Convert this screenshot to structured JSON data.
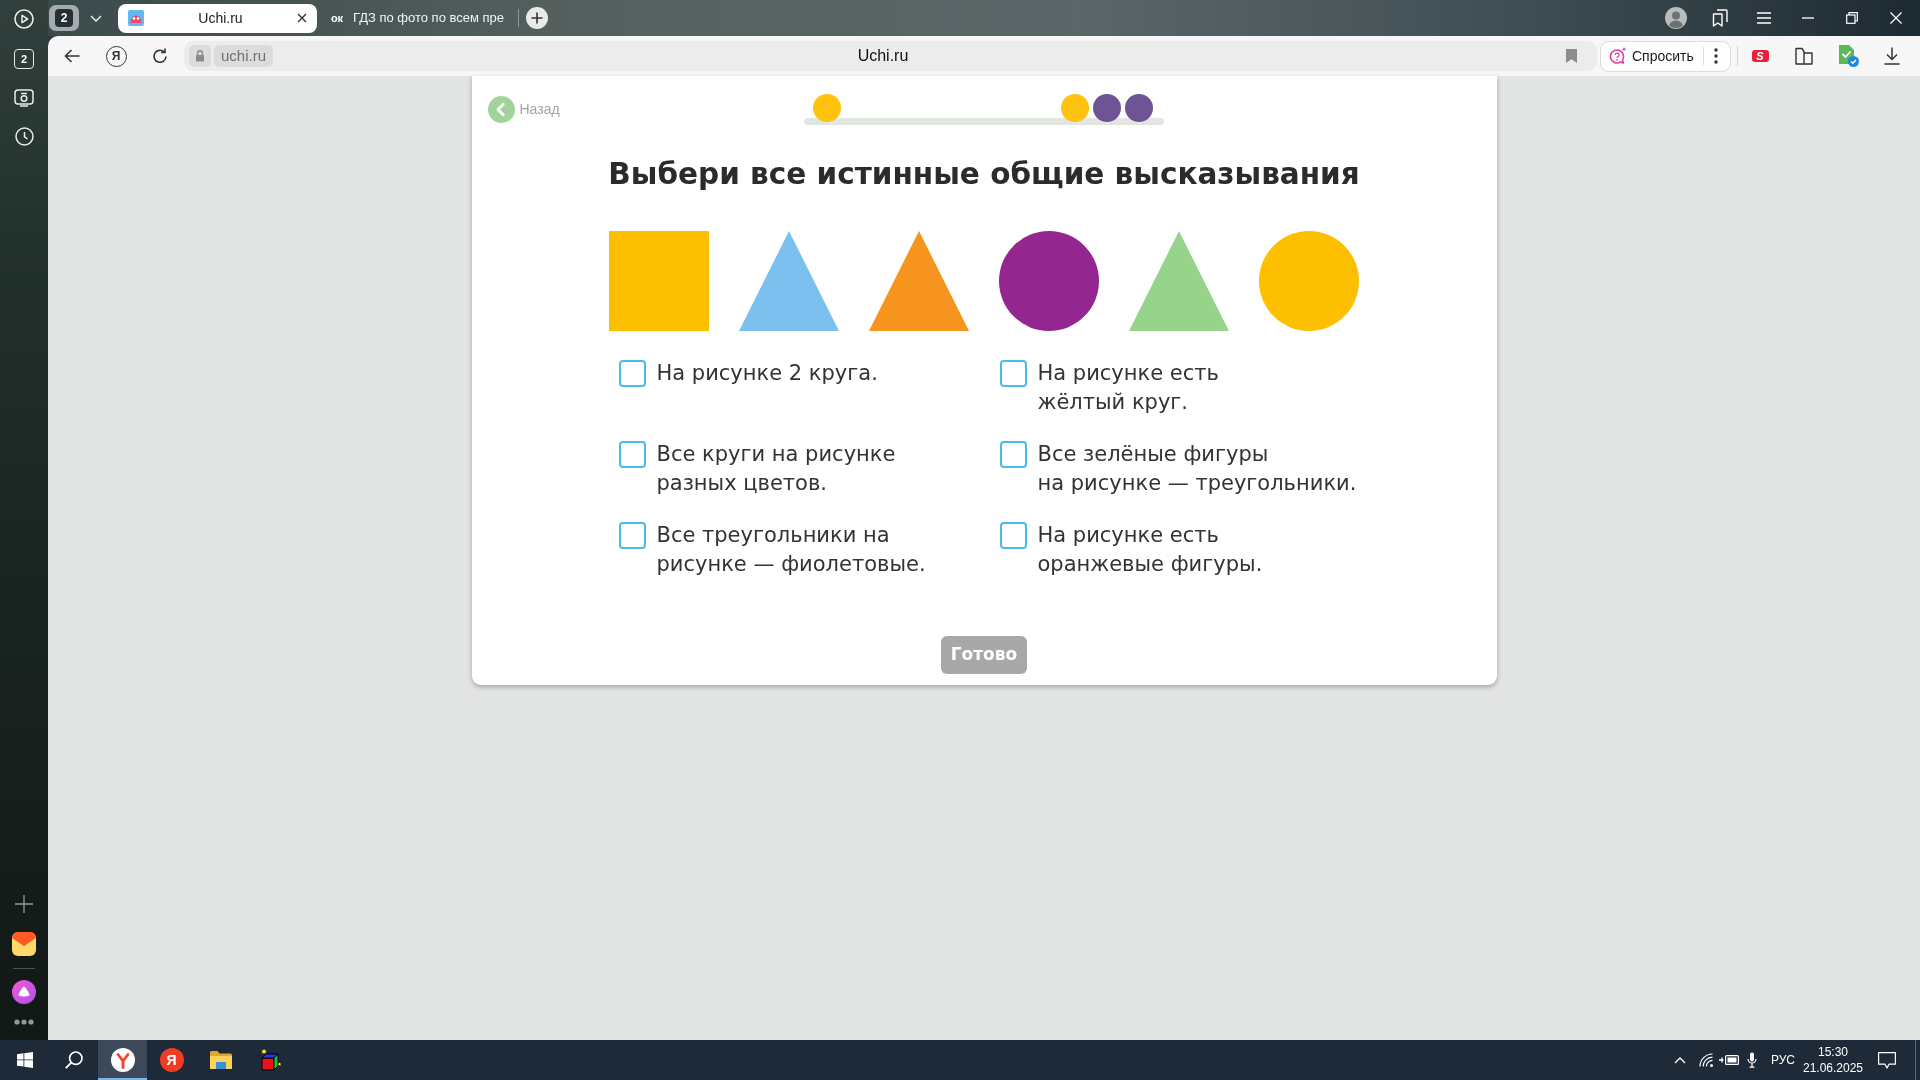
{
  "sidebar": {
    "tab_count": "2"
  },
  "tab_strip": {
    "tab_group_count": "2",
    "tabs": [
      {
        "title": "Uchi.ru",
        "selected": true
      },
      {
        "favicon_text": "ок",
        "title": "ГДЗ по фото по всем пре",
        "selected": false
      }
    ]
  },
  "toolbar": {
    "home_logo": "Я",
    "address": {
      "domain": "uchi.ru",
      "page_title": "Uchi.ru"
    },
    "ask_button": "Спросить",
    "extension_logo": "S"
  },
  "lesson": {
    "back_link": "Назад",
    "progress": {
      "start_dots": [
        {
          "color": "#ffc20e"
        }
      ],
      "end_dots": [
        {
          "color": "#ffc20e"
        },
        {
          "color": "#6e5494"
        },
        {
          "color": "#6e5494"
        }
      ]
    },
    "title": "Выбери все истинные общие высказывания",
    "shapes": [
      {
        "kind": "square",
        "color": "#fdc000"
      },
      {
        "kind": "triangle",
        "color": "#7cc0ef"
      },
      {
        "kind": "triangle",
        "color": "#f7941d"
      },
      {
        "kind": "circle",
        "color": "#93268f"
      },
      {
        "kind": "triangle",
        "color": "#98d38c"
      },
      {
        "kind": "circle",
        "color": "#fdc000"
      }
    ],
    "options": [
      {
        "text": "На рисунке 2 круга.",
        "checked": false
      },
      {
        "text": "На рисунке есть\nжёлтый круг.",
        "checked": false
      },
      {
        "text": "Все круги на рисунке\nразных цветов.",
        "checked": false
      },
      {
        "text": "Все зелёные фигуры\nна рисунке — треугольники.",
        "checked": false
      },
      {
        "text": "Все треугольники на\nрисунке — фиолетовые.",
        "checked": false
      },
      {
        "text": "На рисунке есть\nоранжевые фигуры.",
        "checked": false
      }
    ],
    "submit": {
      "label": "Готово",
      "disabled": true
    }
  },
  "taskbar": {
    "apps": [
      {
        "kind": "browser",
        "selected": true
      },
      {
        "kind": "letter",
        "label": "Я",
        "selected": false
      },
      {
        "kind": "folder",
        "selected": false
      },
      {
        "kind": "cube",
        "selected": false
      }
    ],
    "language": "РУС",
    "time": "15:30",
    "date": "21.06.2025"
  }
}
